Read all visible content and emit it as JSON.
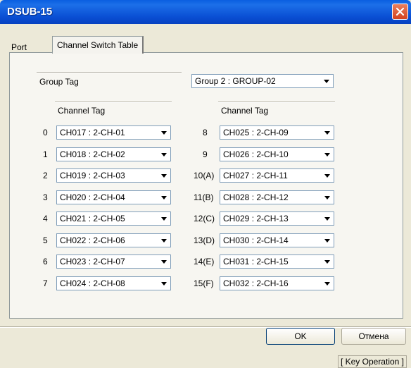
{
  "window": {
    "title": "DSUB-15"
  },
  "tabs": [
    "Port",
    "Channel Switch Table"
  ],
  "group": {
    "label": "Group Tag",
    "value": "Group 2 : GROUP-02"
  },
  "channel_header": "Channel Tag",
  "left_channels": [
    {
      "index": "0",
      "value": "CH017 : 2-CH-01"
    },
    {
      "index": "1",
      "value": "CH018 : 2-CH-02"
    },
    {
      "index": "2",
      "value": "CH019 : 2-CH-03"
    },
    {
      "index": "3",
      "value": "CH020 : 2-CH-04"
    },
    {
      "index": "4",
      "value": "CH021 : 2-CH-05"
    },
    {
      "index": "5",
      "value": "CH022 : 2-CH-06"
    },
    {
      "index": "6",
      "value": "CH023 : 2-CH-07"
    },
    {
      "index": "7",
      "value": "CH024 : 2-CH-08"
    }
  ],
  "right_channels": [
    {
      "index": "8",
      "value": "CH025 : 2-CH-09"
    },
    {
      "index": "9",
      "value": "CH026 : 2-CH-10"
    },
    {
      "index": "10(A)",
      "value": "CH027 : 2-CH-11"
    },
    {
      "index": "11(B)",
      "value": "CH028 : 2-CH-12"
    },
    {
      "index": "12(C)",
      "value": "CH029 : 2-CH-13"
    },
    {
      "index": "13(D)",
      "value": "CH030 : 2-CH-14"
    },
    {
      "index": "14(E)",
      "value": "CH031 : 2-CH-15"
    },
    {
      "index": "15(F)",
      "value": "CH032 : 2-CH-16"
    }
  ],
  "buttons": {
    "ok": "OK",
    "cancel": "Отмена"
  },
  "status": "[ Key Operation ]",
  "icons": {
    "close": "close-icon",
    "dropdown": "chevron-down-icon"
  }
}
